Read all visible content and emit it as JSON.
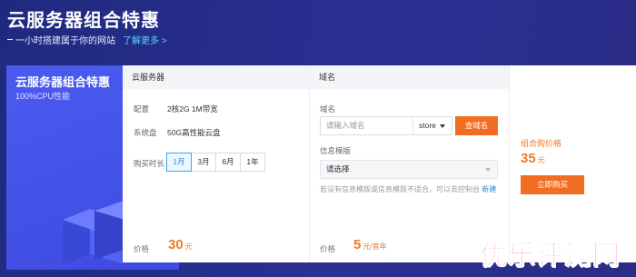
{
  "hero": {
    "title": "云服务器组合特惠",
    "subtitle": "一小时搭建属于你的网站",
    "link": "了解更多",
    "link_chevron": ">"
  },
  "promo": {
    "title": "云服务器组合特惠",
    "subtitle": "100%CPU性能"
  },
  "server_section": {
    "header": "云服务器",
    "config_label": "配置",
    "config_value": "2核2G  1M带宽",
    "disk_label": "系统盘",
    "disk_value": "50G高性能云盘",
    "duration_label": "购买时长",
    "durations": [
      "1月",
      "3月",
      "6月",
      "1年"
    ],
    "selected_duration": "1月",
    "price_label": "价格",
    "price_value": "30",
    "price_unit": "元"
  },
  "domain_section": {
    "header": "域名",
    "domain_label": "域名",
    "domain_placeholder": "请输入域名",
    "suffix_value": "store",
    "search_label": "查域名",
    "template_label": "信息模版",
    "template_value": "请选择",
    "note_text": "若没有信息模版或信息模版不适合，可以去控制台",
    "note_link": "新建",
    "price_label": "价格",
    "price_value": "5",
    "price_unit": "元/首年"
  },
  "order": {
    "label": "组合购价格",
    "price_value": "35",
    "price_unit": "元",
    "buy_label": "立即购买"
  },
  "watermark": "优乐评测网",
  "colors": {
    "accent_orange": "#f26d21",
    "hero_bg": "#262a8a",
    "promo_blue": "#4c5bef",
    "link_blue": "#2a89d8"
  }
}
